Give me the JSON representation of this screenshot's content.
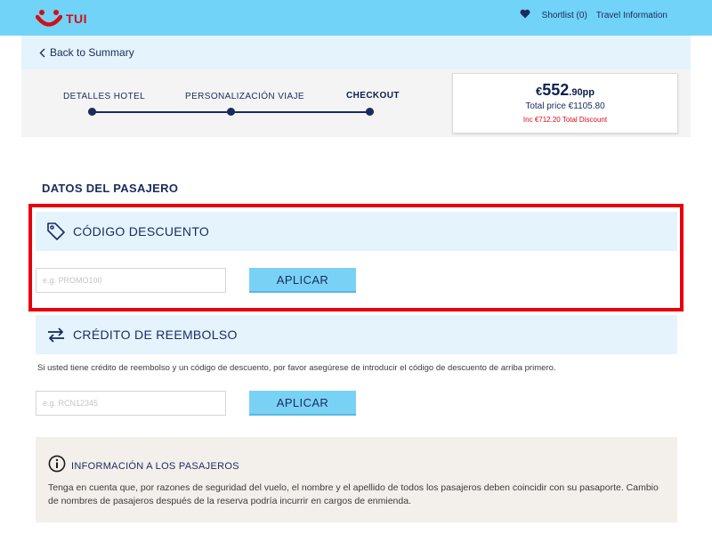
{
  "header": {
    "logo_text": "TUI",
    "shortlist_label": "Shortlist (0)",
    "travel_info_label": "Travel Information"
  },
  "nav": {
    "back_label": "Back to Summary"
  },
  "steps": [
    {
      "label": "DETALLES HOTEL",
      "active": false
    },
    {
      "label": "PERSONALIZACIÓN VIAJE",
      "active": false
    },
    {
      "label": "CHECKOUT",
      "active": true
    }
  ],
  "price": {
    "currency": "€",
    "integer": "552",
    "decimal": ".90pp",
    "total": "Total price €1105.80",
    "discount": "Inc €712.20 Total Discount"
  },
  "passenger": {
    "section_title": "DATOS DEL PASAJERO",
    "discount_code": {
      "title": "CÓDIGO DESCUENTO",
      "placeholder": "e.g. PROMO100",
      "value": "",
      "button_label": "APLICAR"
    },
    "refund_credit": {
      "title": "CRÉDITO DE REEMBOLSO",
      "help_text": "Si usted tiene crédito de reembolso y un código de descuento, por favor asegúrese de introducir el código de descuento de arriba primero.",
      "placeholder": "e.g. RCN12345",
      "value": "",
      "button_label": "APLICAR"
    }
  },
  "info": {
    "title": "INFORMACIÓN A LOS PASAJEROS",
    "body": "Tenga en cuenta que, por razones de seguridad del vuelo, el nombre y el apellido de todos los pasajeros deben coincidir con su pasaporte. Cambio de nombres de pasajeros después de la reserva podría incurrir en cargos de enmienda."
  },
  "icons": {
    "logo": "tui-smile-logo-icon",
    "shortlist": "heart-icon",
    "back": "chevron-left-icon",
    "discount": "tag-icon",
    "refund": "swap-arrows-icon",
    "info": "info-circle-icon"
  },
  "colors": {
    "topbar": "#71d3f7",
    "panel": "#e5f3fc",
    "button": "#79d2f5",
    "navy": "#1a2b5e",
    "brand_red": "#d40e14",
    "highlight": "#e8000d",
    "info_box": "#f3efea"
  }
}
